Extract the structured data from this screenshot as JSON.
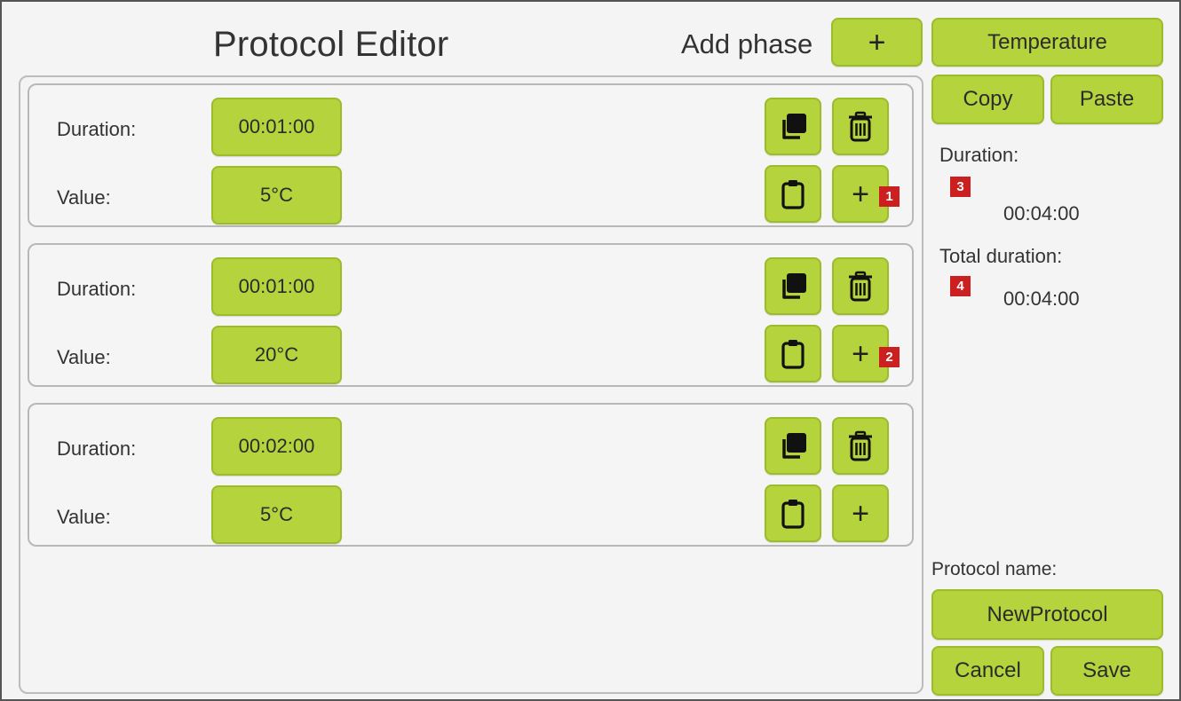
{
  "header": {
    "title": "Protocol Editor",
    "add_phase_label": "Add phase",
    "add_phase_icon": "+"
  },
  "phases": [
    {
      "duration_label": "Duration:",
      "duration": "00:01:00",
      "value_label": "Value:",
      "value": "5°C"
    },
    {
      "duration_label": "Duration:",
      "duration": "00:01:00",
      "value_label": "Value:",
      "value": "20°C"
    },
    {
      "duration_label": "Duration:",
      "duration": "00:02:00",
      "value_label": "Value:",
      "value": "5°C"
    }
  ],
  "phase_add_icon": "+",
  "side": {
    "type_button": "Temperature",
    "copy_button": "Copy",
    "paste_button": "Paste",
    "duration_label": "Duration:",
    "duration_value": "00:04:00",
    "total_label": "Total duration:",
    "total_value": "00:04:00",
    "name_label": "Protocol name:",
    "name_value": "NewProtocol",
    "cancel_button": "Cancel",
    "save_button": "Save"
  },
  "markers": [
    "1",
    "2",
    "3",
    "4"
  ],
  "icons": {
    "phase_copy": "duplicate-icon",
    "phase_delete": "trash-icon",
    "phase_paste": "clipboard-icon",
    "phase_add": "plus-icon"
  },
  "colors": {
    "button_fill": "#b5d33d",
    "button_border": "#9cbc2b",
    "marker": "#cc1f1f",
    "background": "#f4f4f4"
  }
}
